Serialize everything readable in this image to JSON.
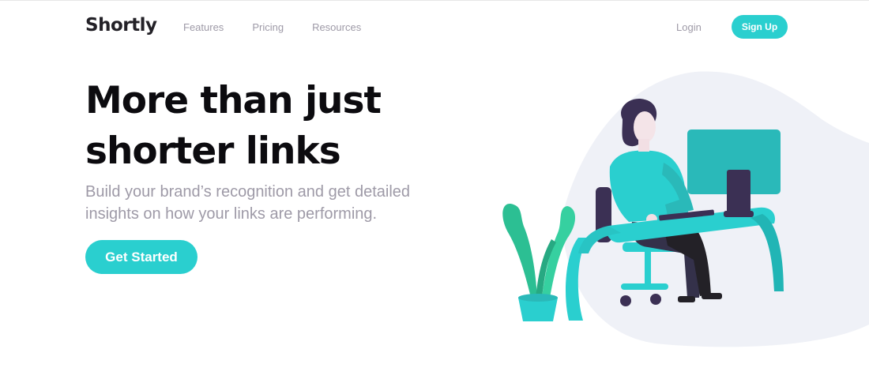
{
  "header": {
    "logo": "Shortly",
    "nav": [
      {
        "label": "Features"
      },
      {
        "label": "Pricing"
      },
      {
        "label": "Resources"
      }
    ],
    "login_label": "Login",
    "signup_label": "Sign Up"
  },
  "hero": {
    "title": "More than just shorter links",
    "subtitle": "Build your brand’s recognition and get detailed insights on how your links are performing.",
    "cta_label": "Get Started"
  },
  "colors": {
    "accent": "#2acfcf",
    "heading": "#0c0b0f",
    "muted": "#9e9aa7",
    "blob": "#eff1f7"
  },
  "illustration": {
    "icon": "person-working-at-computer-illustration"
  }
}
